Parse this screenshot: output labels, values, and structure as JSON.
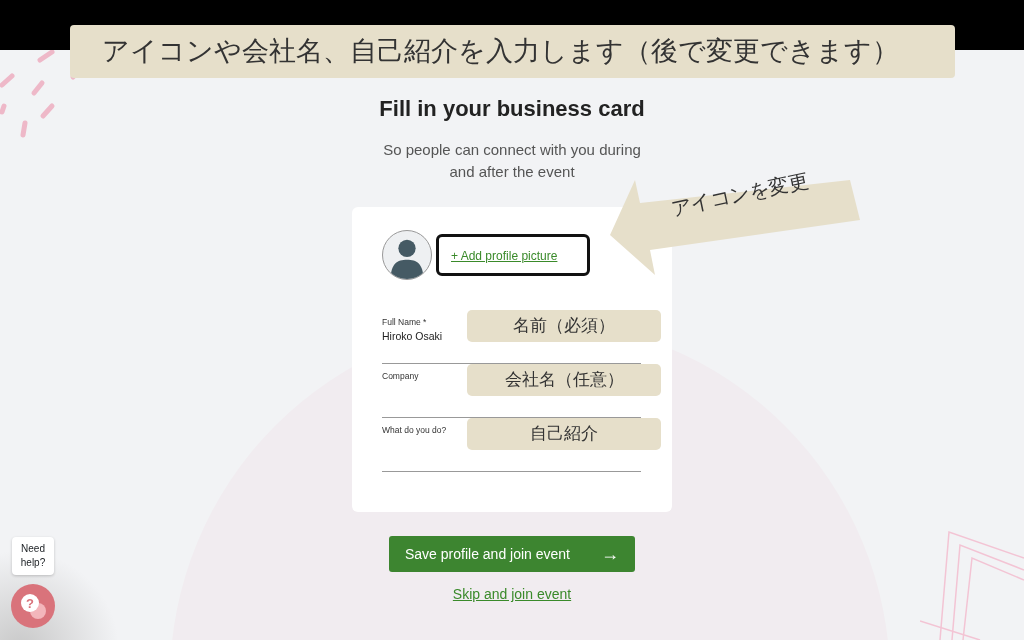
{
  "caption": "アイコンや会社名、自己紹介を入力します（後で変更できます）",
  "title": "Fill in your business card",
  "subtitle": "So people can connect with you during and after the event",
  "profile": {
    "link": "+ Add profile picture",
    "highlighted": true
  },
  "callout": "アイコンを変更",
  "fields": [
    {
      "label": "Full Name *",
      "value": "Hiroko Osaki",
      "note": "名前（必須）"
    },
    {
      "label": "Company",
      "note": "会社名（任意）"
    },
    {
      "label": "What do you do?",
      "note": "自己紹介"
    }
  ],
  "primary_button": {
    "label": "Save profile and join event",
    "arrow": "→"
  },
  "skip_link": "Skip and join event",
  "help": {
    "bubble": "Need help?",
    "glyph": "?"
  }
}
